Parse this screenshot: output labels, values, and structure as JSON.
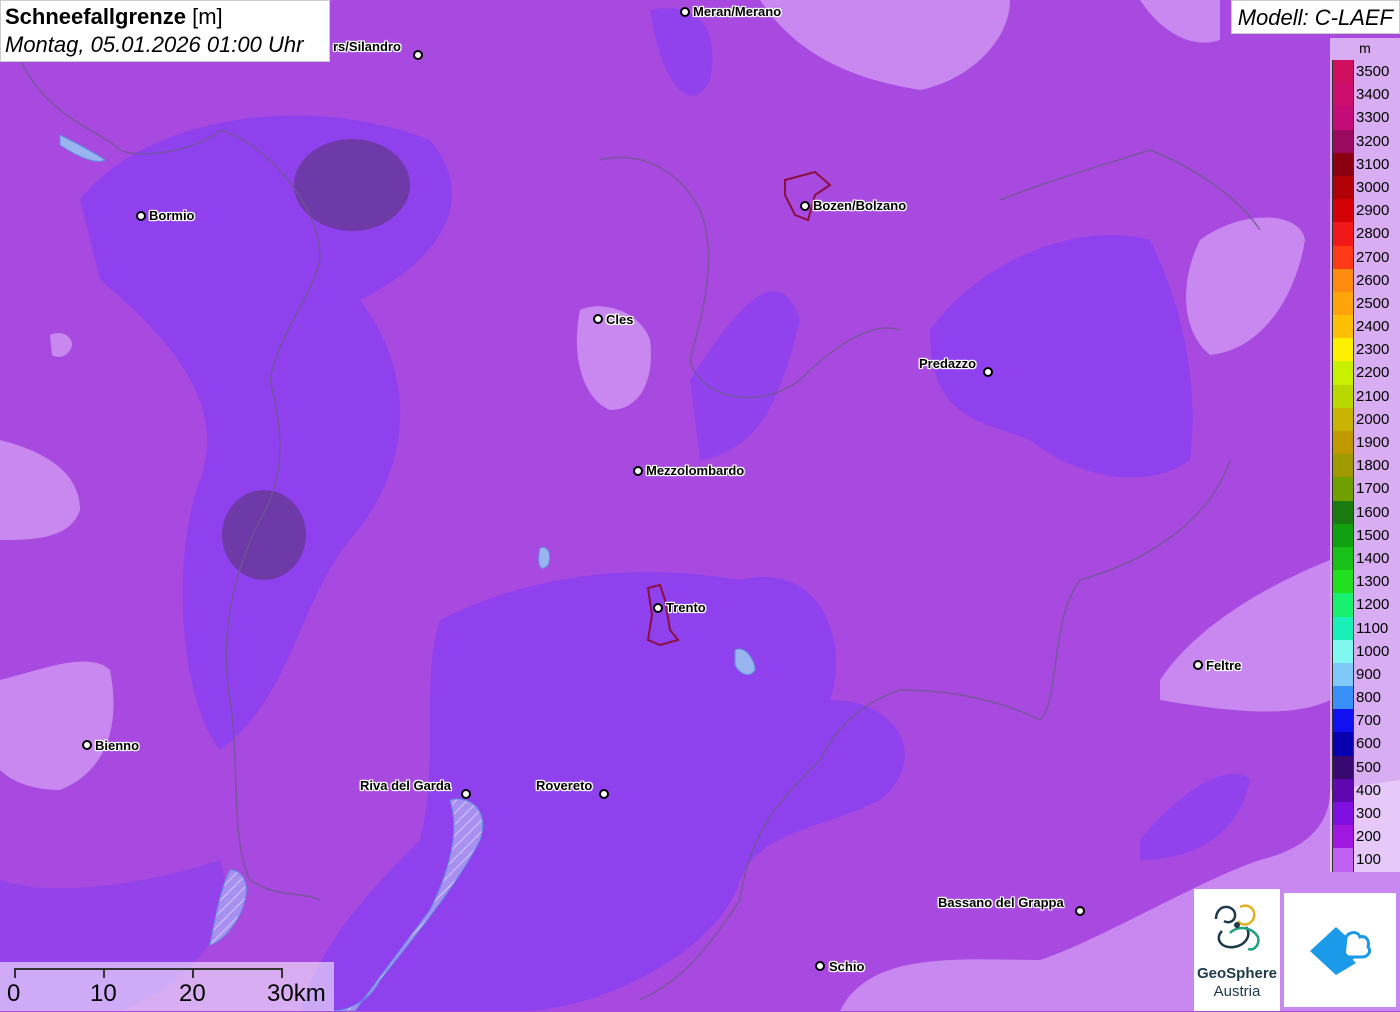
{
  "header": {
    "title_bold": "Schneefallgrenze",
    "title_unit": "[m]",
    "datetime": "Montag, 05.01.2026 01:00 Uhr"
  },
  "model": {
    "label": "Modell: C-LAEF"
  },
  "legend": {
    "unit": "m",
    "items": [
      {
        "label": "3500",
        "color": "#d0105e"
      },
      {
        "label": "3400",
        "color": "#cc0f6e"
      },
      {
        "label": "3300",
        "color": "#c40c78"
      },
      {
        "label": "3200",
        "color": "#9a0b60"
      },
      {
        "label": "3100",
        "color": "#8a0010"
      },
      {
        "label": "3000",
        "color": "#b00008"
      },
      {
        "label": "2900",
        "color": "#d40008"
      },
      {
        "label": "2800",
        "color": "#f01818"
      },
      {
        "label": "2700",
        "color": "#ff3a18"
      },
      {
        "label": "2600",
        "color": "#ff8a10"
      },
      {
        "label": "2500",
        "color": "#ffa40a"
      },
      {
        "label": "2400",
        "color": "#ffbf06"
      },
      {
        "label": "2300",
        "color": "#fff000"
      },
      {
        "label": "2200",
        "color": "#c8f000"
      },
      {
        "label": "2100",
        "color": "#b8d800"
      },
      {
        "label": "2000",
        "color": "#c8b400"
      },
      {
        "label": "1900",
        "color": "#c09800"
      },
      {
        "label": "1800",
        "color": "#a09a00"
      },
      {
        "label": "1700",
        "color": "#70a000"
      },
      {
        "label": "1600",
        "color": "#1a7a10"
      },
      {
        "label": "1500",
        "color": "#10a010"
      },
      {
        "label": "1400",
        "color": "#18c018"
      },
      {
        "label": "1300",
        "color": "#20e020"
      },
      {
        "label": "1200",
        "color": "#18f070"
      },
      {
        "label": "1100",
        "color": "#18f0b8"
      },
      {
        "label": "1000",
        "color": "#80f8f0"
      },
      {
        "label": "900",
        "color": "#80c8f8"
      },
      {
        "label": "800",
        "color": "#3890f8"
      },
      {
        "label": "700",
        "color": "#1010f0"
      },
      {
        "label": "600",
        "color": "#0800b0"
      },
      {
        "label": "500",
        "color": "#380a70"
      },
      {
        "label": "400",
        "color": "#6008b0"
      },
      {
        "label": "300",
        "color": "#8010e0"
      },
      {
        "label": "200",
        "color": "#a018e0"
      },
      {
        "label": "100",
        "color": "#c060f0"
      }
    ]
  },
  "cities": [
    {
      "name": "Meran/Merano"
    },
    {
      "name": "rs/Silandro"
    },
    {
      "name": "Bormio"
    },
    {
      "name": "Bozen/Bolzano"
    },
    {
      "name": "Cles"
    },
    {
      "name": "Predazzo"
    },
    {
      "name": "Mezzolombardo"
    },
    {
      "name": "Trento"
    },
    {
      "name": "Feltre"
    },
    {
      "name": "Bienno"
    },
    {
      "name": "Riva del Garda"
    },
    {
      "name": "Rovereto"
    },
    {
      "name": "Bassano del Grappa"
    },
    {
      "name": "Schio"
    }
  ],
  "scale": {
    "labels": [
      "0",
      "10",
      "20",
      "30km"
    ]
  },
  "logos": {
    "geosphere_name": "GeoSphere",
    "geosphere_sub": "Austria"
  },
  "colors": {
    "base": "#a84ae0",
    "violet": "#8a3cf0",
    "light": "#c888f0",
    "dark": "#6a3aa0"
  }
}
